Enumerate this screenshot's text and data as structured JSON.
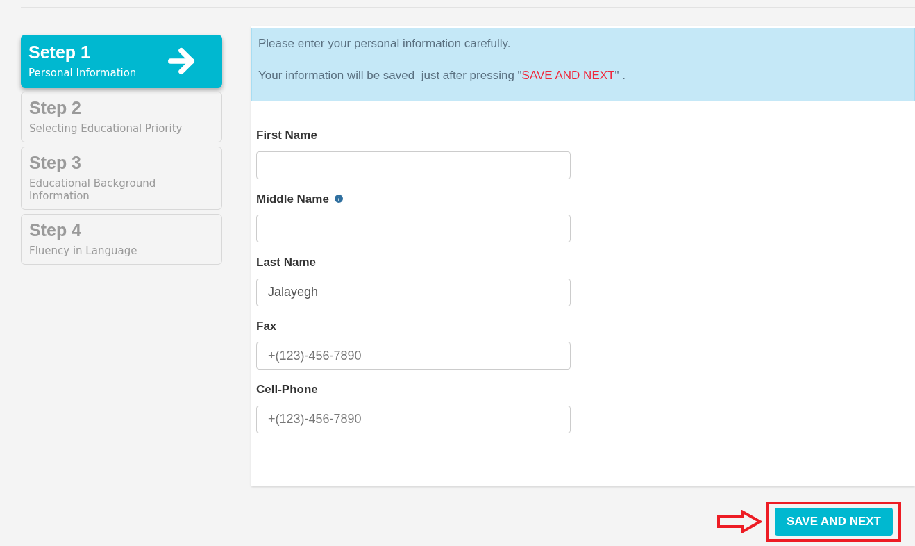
{
  "steps": [
    {
      "title": "Setep 1",
      "description": "Personal Information",
      "selected": true
    },
    {
      "title": "Step 2",
      "description": "Selecting Educational Priority",
      "selected": false
    },
    {
      "title": "Step 3",
      "description": "Educational Background Information",
      "selected": false
    },
    {
      "title": "Step 4",
      "description": "Fluency in Language",
      "selected": false
    }
  ],
  "notice": {
    "line_1": "Please enter your personal information carefully.",
    "line_2_before": "Your information will be saved  just after pressing \"",
    "line_2_highlight": "SAVE AND NEXT",
    "line_2_after": "\" ."
  },
  "fields": [
    {
      "label": "First Name",
      "info": false
    },
    {
      "label": "Middle Name",
      "info": true
    },
    {
      "label": "Last Name",
      "info": false,
      "value": "Jalayegh"
    },
    {
      "label": "Fax",
      "info": false,
      "placeholder": "+(123)-456-7890"
    },
    {
      "label": "Cell-Phone",
      "info": false,
      "placeholder": "+(123)-456-7890"
    }
  ],
  "save_button": {
    "label": "SAVE AND NEXT",
    "highlighted": true
  }
}
